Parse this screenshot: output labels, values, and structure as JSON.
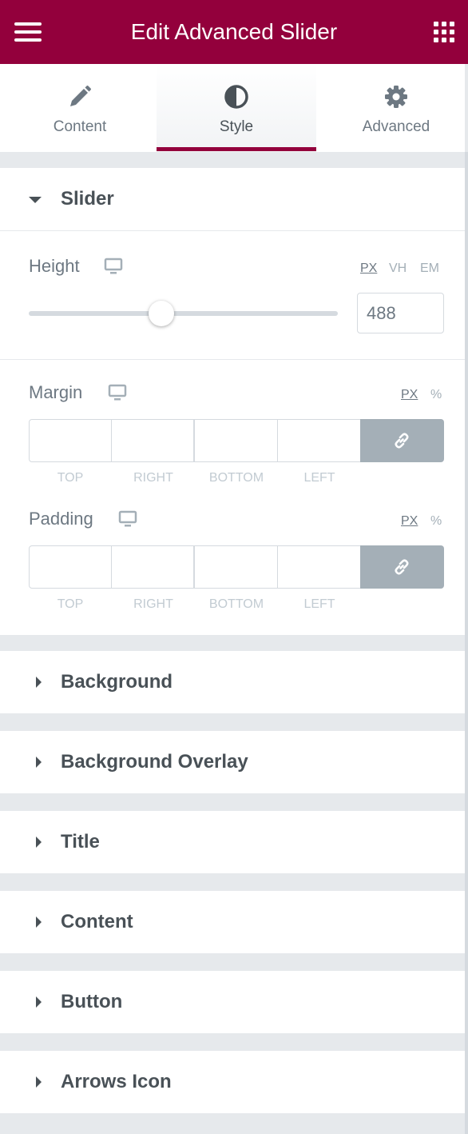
{
  "header": {
    "title": "Edit Advanced Slider"
  },
  "tabs": [
    {
      "label": "Content",
      "icon": "pencil-icon"
    },
    {
      "label": "Style",
      "icon": "half-circle-icon"
    },
    {
      "label": "Advanced",
      "icon": "gear-icon"
    }
  ],
  "active_tab": "Style",
  "colors": {
    "brand": "#93003c",
    "label": "#6d7882",
    "heading": "#495157",
    "muted": "#a4afb7"
  },
  "slider_section": {
    "title": "Slider",
    "height": {
      "label": "Height",
      "units": [
        "PX",
        "VH",
        "EM"
      ],
      "active_unit": "PX",
      "value": "488",
      "slider_fraction": 0.43
    },
    "margin": {
      "label": "Margin",
      "units": [
        "PX",
        "%"
      ],
      "active_unit": "PX",
      "fields": [
        "TOP",
        "RIGHT",
        "BOTTOM",
        "LEFT"
      ]
    },
    "padding": {
      "label": "Padding",
      "units": [
        "PX",
        "%"
      ],
      "active_unit": "PX",
      "fields": [
        "TOP",
        "RIGHT",
        "BOTTOM",
        "LEFT"
      ]
    }
  },
  "sections": [
    {
      "title": "Background"
    },
    {
      "title": "Background Overlay"
    },
    {
      "title": "Title"
    },
    {
      "title": "Content"
    },
    {
      "title": "Button"
    },
    {
      "title": "Arrows Icon"
    }
  ]
}
